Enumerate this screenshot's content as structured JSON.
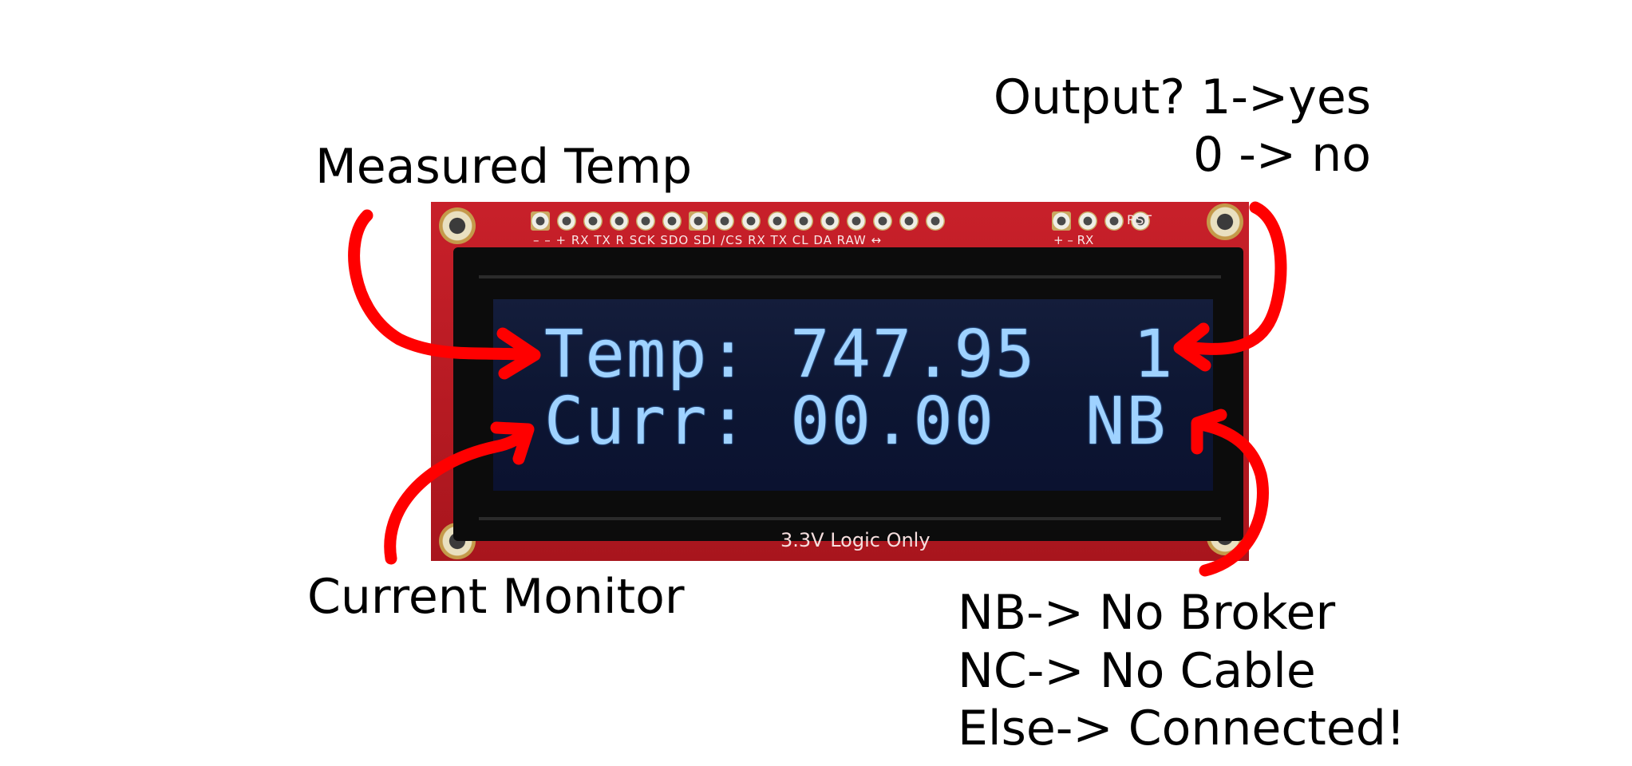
{
  "annotations": {
    "measured_temp": "Measured Temp",
    "output_line1": "Output? 1->yes",
    "output_line2": "0 -> no",
    "current_monitor": "Current Monitor",
    "nb_line": "NB-> No Broker",
    "nc_line": "NC-> No Cable",
    "else_line": "Else-> Connected!"
  },
  "lcd": {
    "row1_label_value": "Temp: 747.95",
    "row1_flag": "1",
    "row2_label_value": "Curr: 00.00",
    "row2_status": "NB"
  },
  "board": {
    "pin_labels_left": "–  –  +  RX TX  R  SCK SDO SDI /CS RX TX CL DA RAW ↔",
    "pin_labels_right": "+ – RX",
    "rst_label": "RST",
    "silkscreen": "3.3V Logic Only"
  },
  "colors": {
    "arrow": "#ff0000",
    "board": "#c8202a",
    "lcd_text": "#9fd2ff",
    "lcd_background": "#0d1633"
  }
}
